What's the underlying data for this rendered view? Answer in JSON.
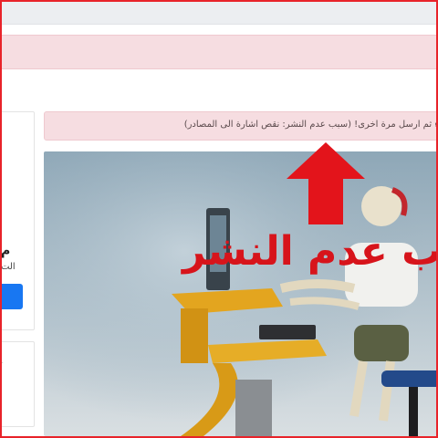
{
  "notice": {
    "text": "ء ثم ارسل مرة اخرى! (سبب عدم النشر: نقص اشارة الى المصادر)"
  },
  "overlay": {
    "label": "ب عدم النشر"
  },
  "sidebar": {
    "fragment_heading": "م",
    "fragment_text": "الت"
  },
  "icons": {
    "arrow": "up-arrow-icon",
    "star": "star-icon"
  },
  "colors": {
    "accent_red": "#d7141b",
    "alert_bg": "#f6dde1",
    "button_blue": "#1877f2"
  }
}
